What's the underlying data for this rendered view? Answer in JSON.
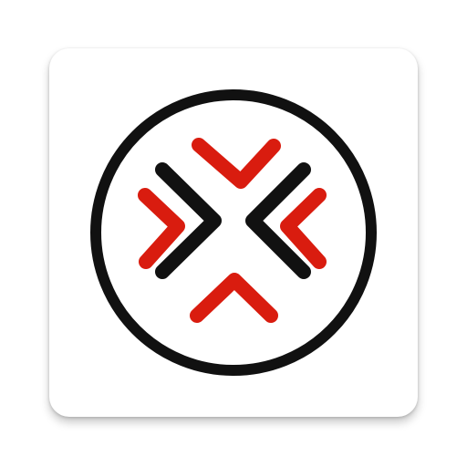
{
  "app_icon": {
    "icon_name": "crosshair-arrows-logo-icon",
    "colors": {
      "background": "#ffffff",
      "ring": "#111111",
      "inner_chevrons": "#111111",
      "outer_chevrons": "#d91c0f"
    }
  }
}
